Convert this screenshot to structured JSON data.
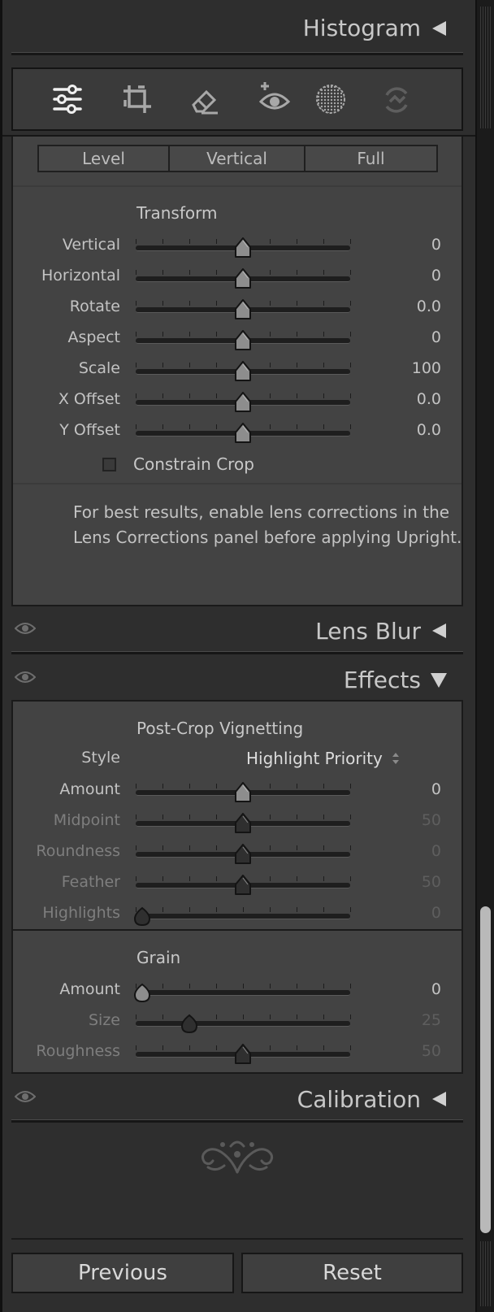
{
  "panels": {
    "histogram": {
      "title": "Histogram"
    },
    "lens_blur": {
      "title": "Lens Blur"
    },
    "effects": {
      "title": "Effects"
    },
    "calibration": {
      "title": "Calibration"
    }
  },
  "toolbar": {
    "tools": [
      "edit-sliders",
      "crop",
      "healing",
      "red-eye",
      "masking",
      "presets"
    ]
  },
  "upright": {
    "buttons": [
      "Level",
      "Vertical",
      "Full"
    ]
  },
  "transform": {
    "title": "Transform",
    "sliders": [
      {
        "label": "Vertical",
        "value": "0",
        "position": 0.5
      },
      {
        "label": "Horizontal",
        "value": "0",
        "position": 0.5
      },
      {
        "label": "Rotate",
        "value": "0.0",
        "position": 0.5
      },
      {
        "label": "Aspect",
        "value": "0",
        "position": 0.5
      },
      {
        "label": "Scale",
        "value": "100",
        "position": 0.5
      },
      {
        "label": "X Offset",
        "value": "0.0",
        "position": 0.5
      },
      {
        "label": "Y Offset",
        "value": "0.0",
        "position": 0.5
      }
    ],
    "constrain_crop": {
      "label": "Constrain Crop",
      "checked": false
    },
    "note_line1": "For best results, enable lens corrections in the",
    "note_line2": "Lens Corrections panel before applying Upright."
  },
  "vignetting": {
    "title": "Post-Crop Vignetting",
    "style_label": "Style",
    "style_value": "Highlight Priority",
    "sliders": [
      {
        "label": "Amount",
        "value": "0",
        "position": 0.5,
        "enabled": true
      },
      {
        "label": "Midpoint",
        "value": "50",
        "position": 0.5,
        "enabled": false
      },
      {
        "label": "Roundness",
        "value": "0",
        "position": 0.5,
        "enabled": false
      },
      {
        "label": "Feather",
        "value": "50",
        "position": 0.5,
        "enabled": false
      },
      {
        "label": "Highlights",
        "value": "0",
        "position": 0.0,
        "enabled": false
      }
    ]
  },
  "grain": {
    "title": "Grain",
    "sliders": [
      {
        "label": "Amount",
        "value": "0",
        "position": 0.0,
        "enabled": true
      },
      {
        "label": "Size",
        "value": "25",
        "position": 0.25,
        "enabled": false
      },
      {
        "label": "Roughness",
        "value": "50",
        "position": 0.5,
        "enabled": false
      }
    ]
  },
  "footer": {
    "previous_label": "Previous",
    "reset_label": "Reset"
  }
}
